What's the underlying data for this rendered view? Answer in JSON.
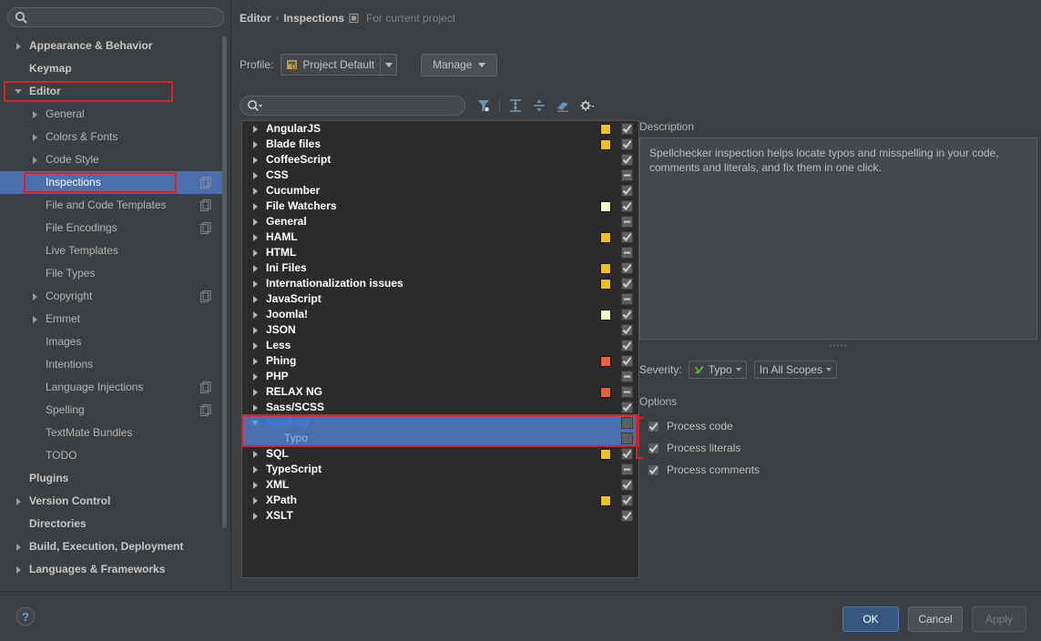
{
  "sidebar": {
    "search_placeholder": "",
    "search_value": "",
    "search_icon": "search-icon",
    "items": [
      {
        "label": "Appearance & Behavior",
        "level": 0,
        "arrow": "collapsed",
        "selected": false,
        "copy_icon": false
      },
      {
        "label": "Keymap",
        "level": 0,
        "arrow": "none",
        "selected": false,
        "copy_icon": false
      },
      {
        "label": "Editor",
        "level": 0,
        "arrow": "expanded",
        "selected": false,
        "copy_icon": false,
        "highlighted": true
      },
      {
        "label": "General",
        "level": 1,
        "arrow": "collapsed",
        "selected": false,
        "copy_icon": false
      },
      {
        "label": "Colors & Fonts",
        "level": 1,
        "arrow": "collapsed",
        "selected": false,
        "copy_icon": false
      },
      {
        "label": "Code Style",
        "level": 1,
        "arrow": "collapsed",
        "selected": false,
        "copy_icon": false
      },
      {
        "label": "Inspections",
        "level": 1,
        "arrow": "none",
        "selected": true,
        "copy_icon": true,
        "highlighted": true
      },
      {
        "label": "File and Code Templates",
        "level": 1,
        "arrow": "none",
        "selected": false,
        "copy_icon": true
      },
      {
        "label": "File Encodings",
        "level": 1,
        "arrow": "none",
        "selected": false,
        "copy_icon": true
      },
      {
        "label": "Live Templates",
        "level": 1,
        "arrow": "none",
        "selected": false,
        "copy_icon": false
      },
      {
        "label": "File Types",
        "level": 1,
        "arrow": "none",
        "selected": false,
        "copy_icon": false
      },
      {
        "label": "Copyright",
        "level": 1,
        "arrow": "collapsed",
        "selected": false,
        "copy_icon": true
      },
      {
        "label": "Emmet",
        "level": 1,
        "arrow": "collapsed",
        "selected": false,
        "copy_icon": false
      },
      {
        "label": "Images",
        "level": 1,
        "arrow": "none",
        "selected": false,
        "copy_icon": false
      },
      {
        "label": "Intentions",
        "level": 1,
        "arrow": "none",
        "selected": false,
        "copy_icon": false
      },
      {
        "label": "Language Injections",
        "level": 1,
        "arrow": "none",
        "selected": false,
        "copy_icon": true
      },
      {
        "label": "Spelling",
        "level": 1,
        "arrow": "none",
        "selected": false,
        "copy_icon": true
      },
      {
        "label": "TextMate Bundles",
        "level": 1,
        "arrow": "none",
        "selected": false,
        "copy_icon": false
      },
      {
        "label": "TODO",
        "level": 1,
        "arrow": "none",
        "selected": false,
        "copy_icon": false
      },
      {
        "label": "Plugins",
        "level": 0,
        "arrow": "none",
        "selected": false,
        "copy_icon": false
      },
      {
        "label": "Version Control",
        "level": 0,
        "arrow": "collapsed",
        "selected": false,
        "copy_icon": false
      },
      {
        "label": "Directories",
        "level": 0,
        "arrow": "none",
        "selected": false,
        "copy_icon": false
      },
      {
        "label": "Build, Execution, Deployment",
        "level": 0,
        "arrow": "collapsed",
        "selected": false,
        "copy_icon": false
      },
      {
        "label": "Languages & Frameworks",
        "level": 0,
        "arrow": "collapsed",
        "selected": false,
        "copy_icon": false
      }
    ]
  },
  "header": {
    "crumb_parent": "Editor",
    "crumb_sep": "›",
    "crumb_current": "Inspections",
    "scope_note": "For current project",
    "scope_icon": "project-scope-icon"
  },
  "profile": {
    "label": "Profile:",
    "value": "Project Default",
    "icon": "profile-icon",
    "manage_label": "Manage"
  },
  "inspection_toolbar": {
    "search_value": "",
    "search_placeholder": "",
    "search_icon": "search-dropdown-icon",
    "buttons": [
      {
        "name": "filter-icon",
        "title": "Filter"
      },
      {
        "name": "expand-all-icon",
        "title": "Expand All"
      },
      {
        "name": "collapse-all-icon",
        "title": "Collapse All"
      },
      {
        "name": "reset-icon",
        "title": "Reset"
      },
      {
        "name": "settings-gear-icon",
        "title": "Settings"
      }
    ]
  },
  "inspections": [
    {
      "label": "AngularJS",
      "level": 0,
      "arrow": "collapsed",
      "severity_color": "#f0c020",
      "checkbox": "checked"
    },
    {
      "label": "Blade files",
      "level": 0,
      "arrow": "collapsed",
      "severity_color": "#f0c020",
      "checkbox": "checked"
    },
    {
      "label": "CoffeeScript",
      "level": 0,
      "arrow": "collapsed",
      "severity_color": null,
      "checkbox": "checked"
    },
    {
      "label": "CSS",
      "level": 0,
      "arrow": "collapsed",
      "severity_color": null,
      "checkbox": "partial"
    },
    {
      "label": "Cucumber",
      "level": 0,
      "arrow": "collapsed",
      "severity_color": null,
      "checkbox": "checked"
    },
    {
      "label": "File Watchers",
      "level": 0,
      "arrow": "collapsed",
      "severity_color": "#fbf8cd",
      "checkbox": "checked"
    },
    {
      "label": "General",
      "level": 0,
      "arrow": "collapsed",
      "severity_color": null,
      "checkbox": "partial"
    },
    {
      "label": "HAML",
      "level": 0,
      "arrow": "collapsed",
      "severity_color": "#f0c020",
      "checkbox": "checked"
    },
    {
      "label": "HTML",
      "level": 0,
      "arrow": "collapsed",
      "severity_color": null,
      "checkbox": "partial"
    },
    {
      "label": "Ini Files",
      "level": 0,
      "arrow": "collapsed",
      "severity_color": "#f0c020",
      "checkbox": "checked"
    },
    {
      "label": "Internationalization issues",
      "level": 0,
      "arrow": "collapsed",
      "severity_color": "#f0c020",
      "checkbox": "checked"
    },
    {
      "label": "JavaScript",
      "level": 0,
      "arrow": "collapsed",
      "severity_color": null,
      "checkbox": "partial"
    },
    {
      "label": "Joomla!",
      "level": 0,
      "arrow": "collapsed",
      "severity_color": "#fbf8cd",
      "checkbox": "checked"
    },
    {
      "label": "JSON",
      "level": 0,
      "arrow": "collapsed",
      "severity_color": null,
      "checkbox": "checked"
    },
    {
      "label": "Less",
      "level": 0,
      "arrow": "collapsed",
      "severity_color": null,
      "checkbox": "checked"
    },
    {
      "label": "Phing",
      "level": 0,
      "arrow": "collapsed",
      "severity_color": "#e8603c",
      "checkbox": "checked"
    },
    {
      "label": "PHP",
      "level": 0,
      "arrow": "collapsed",
      "severity_color": null,
      "checkbox": "partial"
    },
    {
      "label": "RELAX NG",
      "level": 0,
      "arrow": "collapsed",
      "severity_color": "#e8603c",
      "checkbox": "partial"
    },
    {
      "label": "Sass/SCSS",
      "level": 0,
      "arrow": "collapsed",
      "severity_color": null,
      "checkbox": "checked"
    },
    {
      "label": "Spelling",
      "level": 0,
      "arrow": "expanded",
      "severity_color": null,
      "checkbox": "empty",
      "selected": true
    },
    {
      "label": "Typo",
      "level": 1,
      "arrow": "none",
      "severity_color": null,
      "checkbox": "empty",
      "selected": true
    },
    {
      "label": "SQL",
      "level": 0,
      "arrow": "collapsed",
      "severity_color": "#f0c020",
      "checkbox": "checked"
    },
    {
      "label": "TypeScript",
      "level": 0,
      "arrow": "collapsed",
      "severity_color": null,
      "checkbox": "partial"
    },
    {
      "label": "XML",
      "level": 0,
      "arrow": "collapsed",
      "severity_color": null,
      "checkbox": "checked"
    },
    {
      "label": "XPath",
      "level": 0,
      "arrow": "collapsed",
      "severity_color": "#f0c020",
      "checkbox": "checked"
    },
    {
      "label": "XSLT",
      "level": 0,
      "arrow": "collapsed",
      "severity_color": null,
      "checkbox": "checked"
    }
  ],
  "description": {
    "title": "Description",
    "text": "Spellchecker inspection helps locate typos and misspelling in your code, comments and literals, and fix them in one click."
  },
  "severity": {
    "label": "Severity:",
    "value": "Typo",
    "icon": "typo-severity-icon",
    "scope_value": "In All Scopes"
  },
  "options": {
    "title": "Options",
    "items": [
      {
        "label": "Process code",
        "checked": true
      },
      {
        "label": "Process literals",
        "checked": true
      },
      {
        "label": "Process comments",
        "checked": true
      }
    ]
  },
  "footer": {
    "help_icon": "help-icon",
    "ok_label": "OK",
    "cancel_label": "Cancel",
    "apply_label": "Apply"
  },
  "colors": {
    "window_bg": "#3c3f41",
    "tree_bg": "#2b2b2b",
    "selection_blue": "#4b6eaf",
    "highlight_red": "#e02020",
    "primary_button": "#365880"
  }
}
